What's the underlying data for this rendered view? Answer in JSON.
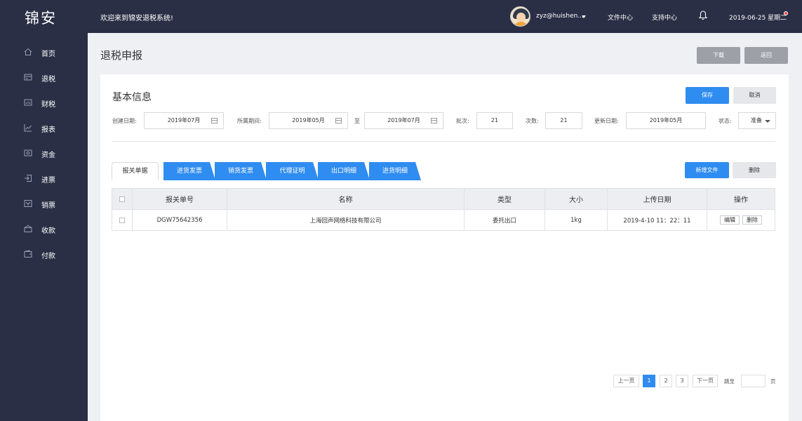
{
  "header": {
    "logo": "锦安",
    "welcome": "欢迎来到锦安退税系统!",
    "user": "zyz@huishen...",
    "links": [
      "文件中心",
      "支持中心"
    ],
    "datetime": "2019-06-25 星期二"
  },
  "sidebar": {
    "items": [
      {
        "label": "首页",
        "icon": "home-icon"
      },
      {
        "label": "退税",
        "icon": "refund-icon"
      },
      {
        "label": "财税",
        "icon": "finance-icon"
      },
      {
        "label": "报表",
        "icon": "report-icon"
      },
      {
        "label": "资金",
        "icon": "funds-icon"
      },
      {
        "label": "进票",
        "icon": "incoming-invoice-icon"
      },
      {
        "label": "销票",
        "icon": "sales-invoice-icon"
      },
      {
        "label": "收款",
        "icon": "receipt-icon"
      },
      {
        "label": "付款",
        "icon": "payment-icon"
      }
    ]
  },
  "page": {
    "title": "退税申报",
    "download_label": "下载",
    "back_label": "返回"
  },
  "basic_info": {
    "title": "基本信息",
    "save_label": "保存",
    "cancel_label": "取消",
    "created_label": "创建日期:",
    "created_value": "2019年07月",
    "period_label": "所属期间:",
    "period_from": "2019年05月",
    "period_to_label": "至",
    "period_to": "2019年07月",
    "batch_label": "批次:",
    "batch_value": "21",
    "count_label": "次数:",
    "count_value": "21",
    "updated_label": "更新日期:",
    "updated_value": "2019年05月",
    "status_label": "状态:",
    "status_value": "准备"
  },
  "tabs": {
    "active": "报关单据",
    "items": [
      "进货发票",
      "销货发票",
      "代理证明",
      "出口明细",
      "进货明细"
    ],
    "add_file_label": "新增文件",
    "delete_label": "删除"
  },
  "table": {
    "headers": [
      "报关单号",
      "名称",
      "类型",
      "大小",
      "上传日期",
      "操作"
    ],
    "rows": [
      {
        "number": "DGW75642356",
        "name": "上海回声网络科技有限公司",
        "type": "委托出口",
        "size": "1kg",
        "date": "2019-4-10 11：22：11",
        "edit": "编辑",
        "delete": "删除"
      }
    ]
  },
  "pagination": {
    "prev": "上一页",
    "pages": [
      "1",
      "2",
      "3"
    ],
    "current": "1",
    "next": "下一页",
    "jump_label": "跳至",
    "page_unit": "页"
  },
  "colors": {
    "sidebar": "#2b2f45",
    "accent": "#2f8cf0"
  }
}
